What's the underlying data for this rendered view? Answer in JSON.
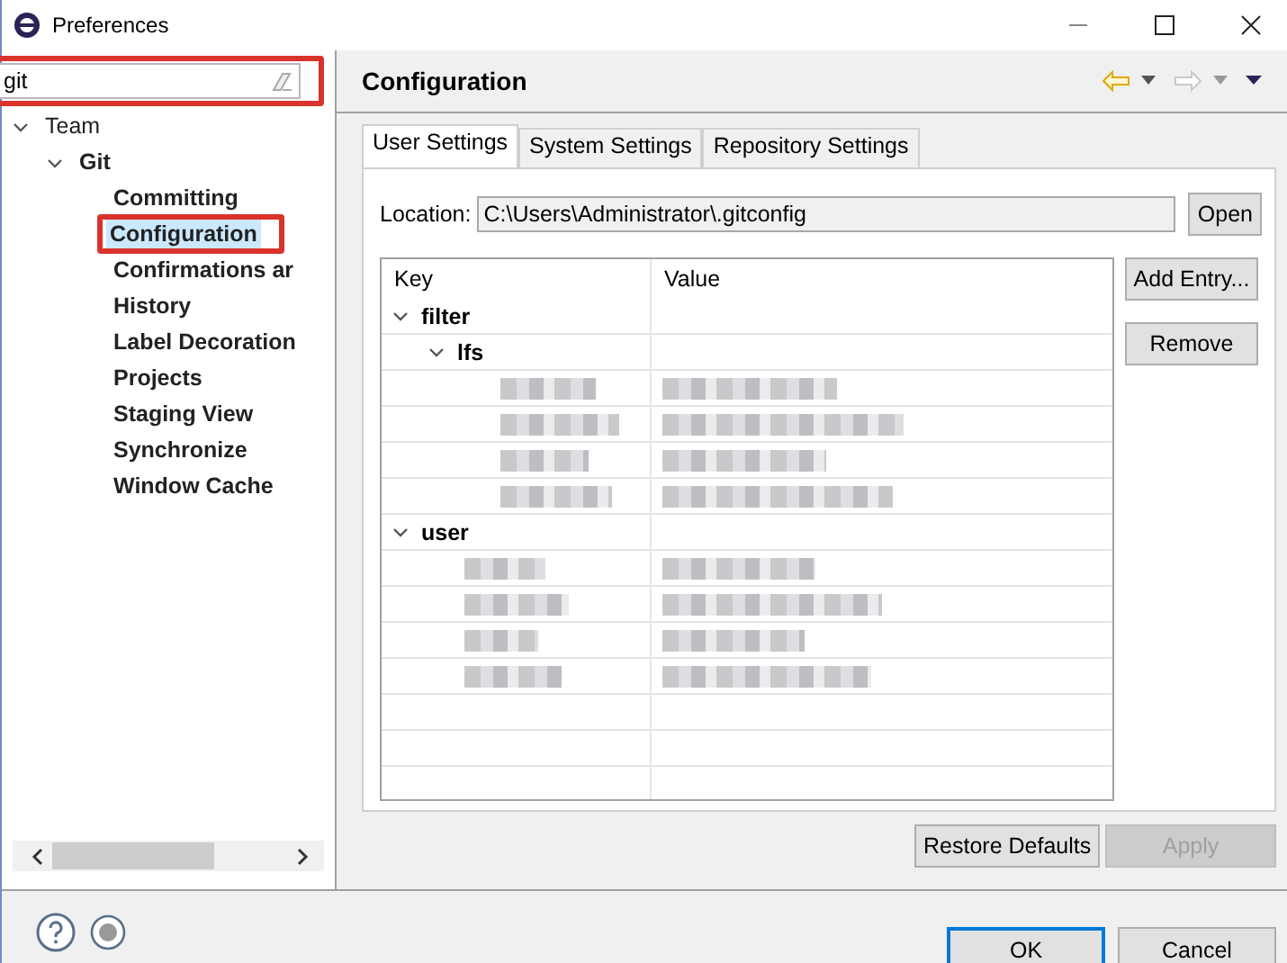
{
  "window": {
    "title": "Preferences"
  },
  "search": {
    "value": "git",
    "highlighted": true
  },
  "tree": [
    {
      "label": "Team",
      "bold": false,
      "expanded": true,
      "selected": false,
      "highlighted": false,
      "children": [
        {
          "label": "Git",
          "bold": true,
          "expanded": true,
          "selected": false,
          "highlighted": false,
          "children": [
            {
              "label": "Committing",
              "bold": true,
              "selected": false,
              "highlighted": false
            },
            {
              "label": "Configuration",
              "bold": true,
              "selected": true,
              "highlighted": true
            },
            {
              "label": "Confirmations ar",
              "bold": true,
              "selected": false,
              "highlighted": false
            },
            {
              "label": "History",
              "bold": true,
              "selected": false,
              "highlighted": false
            },
            {
              "label": "Label Decoration",
              "bold": true,
              "selected": false,
              "highlighted": false
            },
            {
              "label": "Projects",
              "bold": true,
              "selected": false,
              "highlighted": false
            },
            {
              "label": "Staging View",
              "bold": true,
              "selected": false,
              "highlighted": false
            },
            {
              "label": "Synchronize",
              "bold": true,
              "selected": false,
              "highlighted": false
            },
            {
              "label": "Window Cache",
              "bold": true,
              "selected": false,
              "highlighted": false
            }
          ]
        }
      ]
    }
  ],
  "page": {
    "title": "Configuration",
    "back_enabled": true,
    "forward_enabled": false
  },
  "tabs": [
    {
      "label": "User Settings",
      "selected": true
    },
    {
      "label": "System Settings",
      "selected": false
    },
    {
      "label": "Repository Settings",
      "selected": false
    }
  ],
  "location": {
    "label": "Location:",
    "value": "C:\\Users\\Administrator\\.gitconfig"
  },
  "open_button": {
    "label": "Open"
  },
  "table": {
    "columns": [
      "Key",
      "Value"
    ],
    "rows": [
      {
        "kind": "section",
        "key": "filter",
        "expanded": true,
        "children": [
          {
            "kind": "section",
            "key": "lfs",
            "expanded": true,
            "children": [
              {
                "kind": "redacted"
              },
              {
                "kind": "redacted"
              },
              {
                "kind": "redacted"
              },
              {
                "kind": "redacted"
              }
            ]
          }
        ]
      },
      {
        "kind": "section",
        "key": "user",
        "expanded": true,
        "children": [
          {
            "kind": "redacted"
          },
          {
            "kind": "redacted"
          },
          {
            "kind": "redacted"
          },
          {
            "kind": "redacted"
          }
        ]
      }
    ]
  },
  "side_buttons": [
    {
      "label": "Add Entry...",
      "disabled": false
    },
    {
      "label": "Remove",
      "disabled": false
    }
  ],
  "page_buttons": [
    {
      "label": "Restore Defaults",
      "disabled": false
    },
    {
      "label": "Apply",
      "disabled": true
    }
  ],
  "dialog_buttons": [
    {
      "label": "OK",
      "default": true
    },
    {
      "label": "Cancel",
      "default": false
    }
  ]
}
